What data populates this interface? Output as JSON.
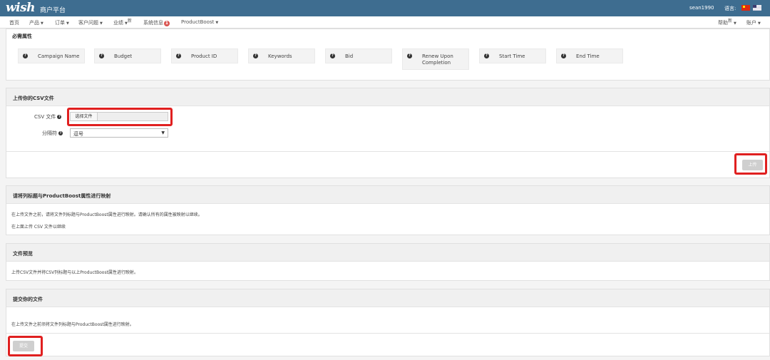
{
  "header": {
    "logo": "wish",
    "subtitle": "商户平台",
    "username": "sean1990",
    "language_label": "语言:"
  },
  "nav": {
    "items": [
      {
        "label": "首页",
        "caret": false
      },
      {
        "label": "产品",
        "caret": true
      },
      {
        "label": "订单",
        "caret": true
      },
      {
        "label": "客户问题",
        "caret": true
      },
      {
        "label": "业绩",
        "caret": true,
        "sup": "新"
      },
      {
        "label": "系统信息",
        "badge": "1"
      },
      {
        "label": "ProductBoost",
        "caret": true
      }
    ],
    "help": {
      "label": "帮助",
      "sup": "新"
    },
    "account": {
      "label": "账户"
    }
  },
  "required_attrs": {
    "title": "必需属性",
    "items": [
      "Campaign Name",
      "Budget",
      "Product ID",
      "Keywords",
      "Bid",
      "Renew Upon Completion",
      "Start Time",
      "End Time"
    ]
  },
  "upload": {
    "title": "上传你的CSV文件",
    "csv_label": "CSV 文件",
    "file_button": "选择文件",
    "delimiter_label": "分隔符",
    "delimiter_value": "逗号",
    "upload_button": "上传"
  },
  "mapping": {
    "title": "请将列标题与ProductBoost属性进行映射",
    "line1": "在上传文件之前，请将文件列标题与ProductBoost属性进行映射。请确认所有的属性被映射以继续。",
    "line2": "在上面上传 CSV 文件以继续"
  },
  "preview": {
    "title": "文件预览",
    "line1": "上传CSV文件并将CSV列标题与以上ProductBoost属性进行映射。"
  },
  "submit": {
    "title": "提交你的文件",
    "line1": "在上传文件之前须将文件列标题与ProductBoost属性进行映射。",
    "button": "提交"
  },
  "colors": {
    "header_bg": "#3e6d90",
    "highlight": "#e02020",
    "disabled_button": "#cfcfcf"
  }
}
